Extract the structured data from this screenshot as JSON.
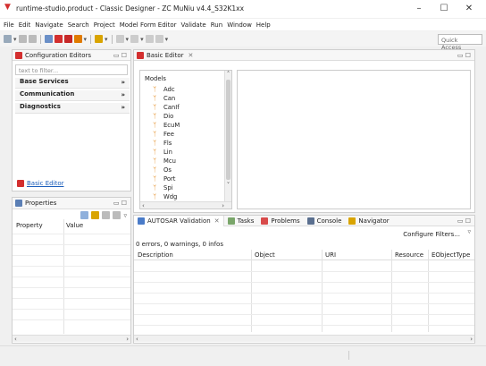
{
  "window": {
    "title": "runtime-studio.product - Classic Designer - ZC MuNiu v4.4_S32K1xx",
    "minimize": "–",
    "maximize": "☐",
    "close": "✕"
  },
  "menubar": [
    "File",
    "Edit",
    "Navigate",
    "Search",
    "Project",
    "Model Form Editor",
    "Validate",
    "Run",
    "Window",
    "Help"
  ],
  "quick_access": "Quick Access",
  "config_editors": {
    "title": "Configuration Editors",
    "filter_placeholder": "text to filter...",
    "sections": [
      "Base Services",
      "Communication",
      "Diagnostics"
    ],
    "basic_editor_link": "Basic Editor"
  },
  "properties": {
    "title": "Properties",
    "col_property": "Property",
    "col_value": "Value"
  },
  "basic_editor": {
    "title": "Basic Editor",
    "tree_root": "Models",
    "items": [
      "Adc",
      "Can",
      "CanIf",
      "Dio",
      "EcuM",
      "Fee",
      "Fls",
      "Lin",
      "Mcu",
      "Os",
      "Port",
      "Spi",
      "Wdg"
    ]
  },
  "bottom_tabs": {
    "tabs": [
      "AUTOSAR Validation",
      "Tasks",
      "Problems",
      "Console",
      "Navigator"
    ],
    "configure_filters": "Configure Filters...",
    "summary": "0 errors, 0 warnings, 0 infos",
    "columns": [
      "Description",
      "Object",
      "URI",
      "Resource",
      "EObjectType"
    ]
  },
  "colors": {
    "accent_red": "#d32f2f",
    "tree_icon_orange": "#e07b00",
    "link_blue": "#1a5dbb"
  }
}
